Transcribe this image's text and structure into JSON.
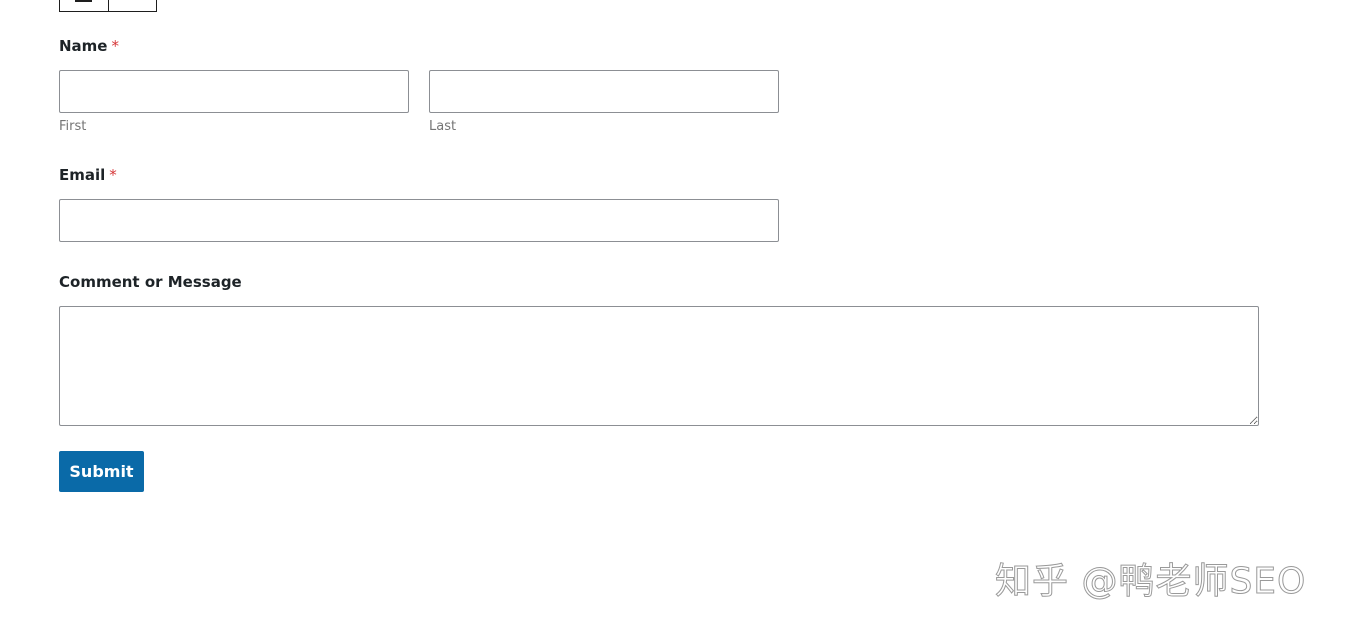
{
  "form": {
    "name": {
      "label": "Name",
      "required_mark": "*",
      "first_value": "",
      "last_value": "",
      "first_sublabel": "First",
      "last_sublabel": "Last"
    },
    "email": {
      "label": "Email",
      "required_mark": "*",
      "value": ""
    },
    "message": {
      "label": "Comment or Message",
      "value": ""
    },
    "submit_label": "Submit"
  },
  "watermark": {
    "text": "知乎 @鸭老师SEO"
  },
  "colors": {
    "accent": "#0a6aa8",
    "required": "#d63638"
  }
}
